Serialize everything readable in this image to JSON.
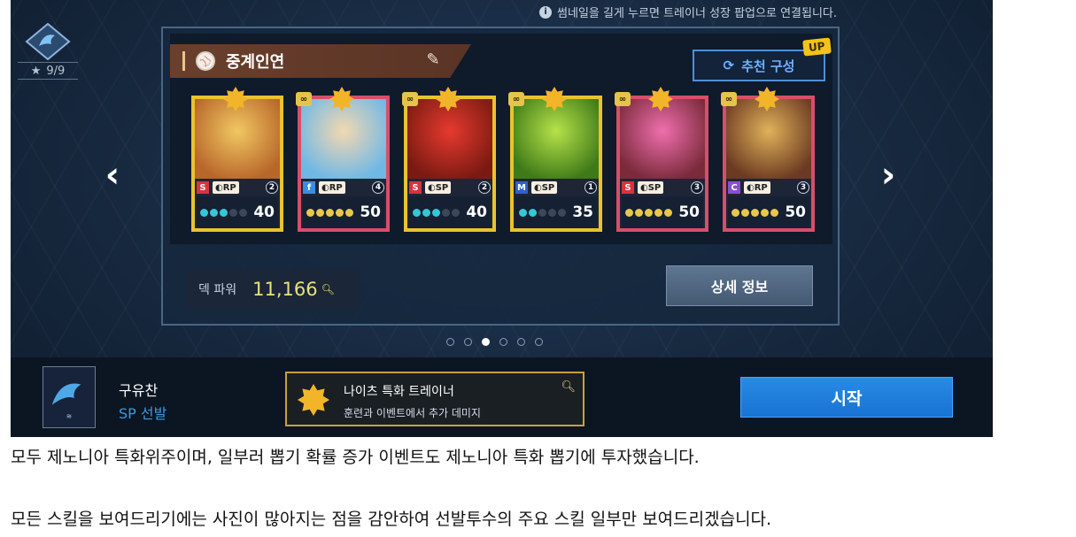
{
  "notice": {
    "icon": "info-icon",
    "text": "썸네일을 길게 누르면 트레이너 성장 팝업으로 연결됩니다."
  },
  "team": {
    "rating": "9/9",
    "emblem_icon": "dragon-emblem-icon"
  },
  "deck": {
    "name": "중계인연",
    "recommend_label": "추천 구성",
    "recommend_badge": "UP",
    "cards": [
      {
        "type": "S",
        "role": "RP",
        "count": "2",
        "level": "40",
        "stars": 3,
        "border": "gold",
        "dot_style": "teal",
        "linked": false
      },
      {
        "type": "f",
        "role": "RP",
        "count": "4",
        "level": "50",
        "stars": 5,
        "border": "pink",
        "dot_style": "gold",
        "linked": true
      },
      {
        "type": "S",
        "role": "SP",
        "count": "2",
        "level": "40",
        "stars": 3,
        "border": "gold",
        "dot_style": "teal",
        "linked": true
      },
      {
        "type": "M",
        "role": "SP",
        "count": "1",
        "level": "35",
        "stars": 2,
        "border": "gold",
        "dot_style": "teal",
        "linked": true
      },
      {
        "type": "S",
        "role": "SP",
        "count": "3",
        "level": "50",
        "stars": 5,
        "border": "pink",
        "dot_style": "gold",
        "linked": true
      },
      {
        "type": "C",
        "role": "RP",
        "count": "3",
        "level": "50",
        "stars": 5,
        "border": "pink",
        "dot_style": "gold",
        "linked": true
      }
    ],
    "power_label": "덱 파워",
    "power_value": "11,166",
    "detail_button": "상세 정보",
    "page_count": 6,
    "active_page": 3
  },
  "bottom": {
    "coach_name": "구유찬",
    "coach_role": "SP 선발",
    "trainer_name": "나이츠 특화 트레이너",
    "trainer_desc": "훈련과 이벤트에서 추가 데미지",
    "start_button": "시작"
  },
  "captions": [
    "모두 제노니아 특화위주이며, 일부러 뽑기 확률 증가 이벤트도 제노니아 특화 뽑기에 투자했습니다.",
    "모든 스킬을 보여드리기에는 사진이 많아지는 점을 감안하여 선발투수의 주요 스킬 일부만 보여드리겠습니다."
  ]
}
